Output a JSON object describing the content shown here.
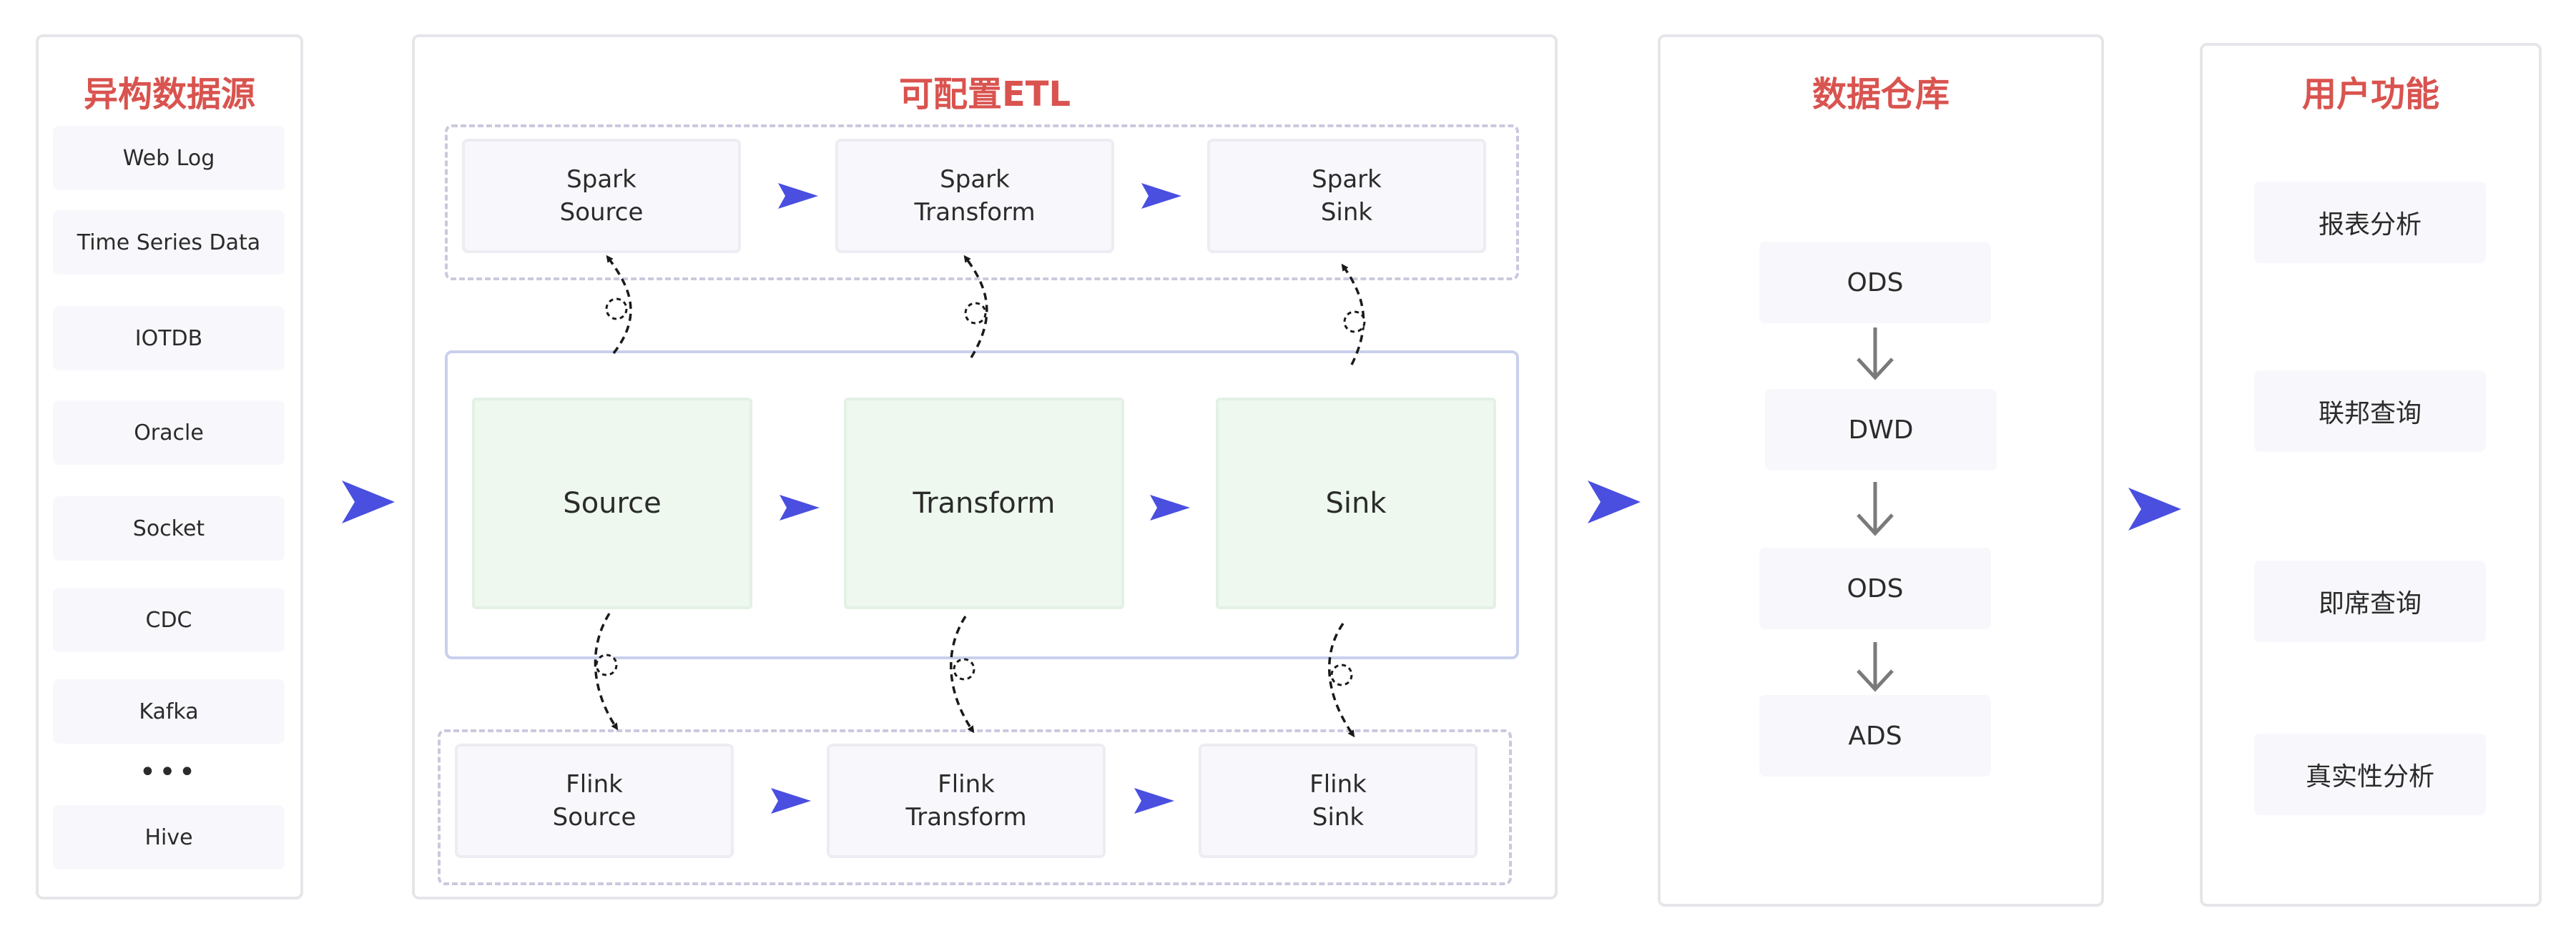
{
  "sources": {
    "title": "异构数据源",
    "items": [
      "Web Log",
      "Time Series Data",
      "IOTDB",
      "Oracle",
      "Socket",
      "CDC",
      "Kafka",
      "Hive"
    ],
    "ellipsis": "•••"
  },
  "etl": {
    "title": "可配置ETL",
    "spark": [
      "Spark\nSource",
      "Spark\nTransform",
      "Spark\nSink"
    ],
    "core": [
      "Source",
      "Transform",
      "Sink"
    ],
    "flink": [
      "Flink\nSource",
      "Flink\nTransform",
      "Flink\nSink"
    ]
  },
  "warehouse": {
    "title": "数据仓库",
    "layers": [
      "ODS",
      "DWD",
      "ODS",
      "ADS"
    ]
  },
  "user": {
    "title": "用户功能",
    "items": [
      "报表分析",
      "联邦查询",
      "即席查询",
      "真实性分析"
    ]
  },
  "colors": {
    "accent_title": "#d9534f",
    "arrow": "#4a4fe0",
    "stage_fill": "#eef8ef"
  }
}
